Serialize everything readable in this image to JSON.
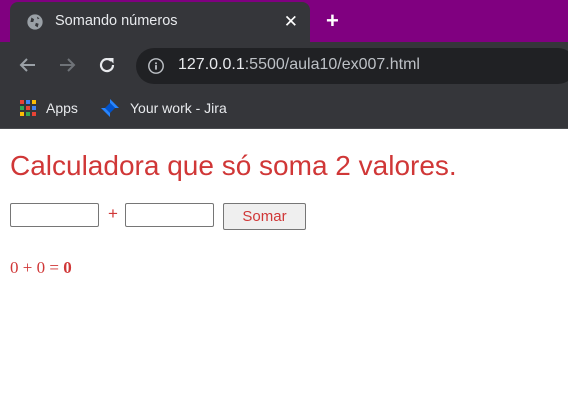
{
  "browser": {
    "tab": {
      "title": "Somando números",
      "close_symbol": "✕"
    },
    "new_tab_symbol": "+",
    "url": {
      "host": "127.0.0.1",
      "path": ":5500/aula10/ex007.html"
    },
    "bookmarks": [
      {
        "label": "Apps",
        "icon": "apps-grid-icon"
      },
      {
        "label": "Your work - Jira",
        "icon": "jira-icon"
      }
    ],
    "colors": {
      "tab_strip": "#800080",
      "toolbar": "#35363a"
    }
  },
  "page": {
    "heading": "Calculadora que só soma 2 valores.",
    "input1_value": "",
    "input2_value": "",
    "plus_sign": "+",
    "button_label": "Somar",
    "result": {
      "expression": "0 + 0 = ",
      "sum": "0"
    },
    "colors": {
      "text": "#d03737"
    }
  }
}
